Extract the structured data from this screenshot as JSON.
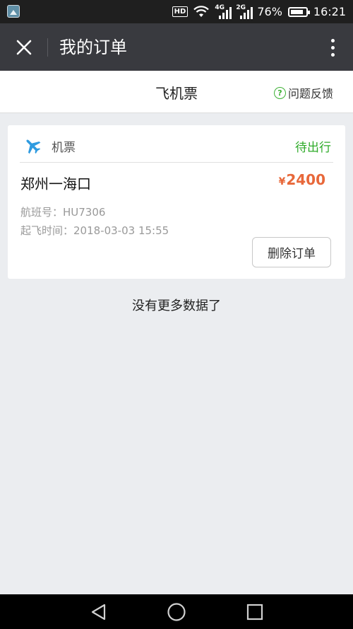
{
  "status_bar": {
    "hd": "HD",
    "network_1": "4G",
    "network_2": "2G",
    "battery_percent": "76%",
    "battery_level": 0.76,
    "time": "16:21",
    "icons": [
      "gallery-icon",
      "wifi-icon",
      "signal-icon",
      "battery-icon"
    ]
  },
  "title_bar": {
    "title": "我的订单",
    "close_icon": "close-icon",
    "more_icon": "more-vertical-icon",
    "background": "#393a3f"
  },
  "sub_header": {
    "title": "飞机票",
    "feedback_label": "问题反馈",
    "feedback_icon": "help-circle-icon"
  },
  "orders": [
    {
      "type_icon": "airplane-icon",
      "type_label": "机票",
      "status": "待出行",
      "route": "郑州一海口",
      "price_currency": "¥",
      "price_amount": "2400",
      "flight_no": "航班号：HU7306",
      "depart_time": "起飞时间：2018-03-03 15:55",
      "delete_label": "删除订单"
    }
  ],
  "footer_text": "没有更多数据了",
  "nav_bar": {
    "icons": [
      "back-icon",
      "home-icon",
      "recent-apps-icon"
    ]
  },
  "colors": {
    "accent_green": "#2fab2a",
    "price_orange": "#e8683a",
    "page_background": "#ebedf0"
  }
}
